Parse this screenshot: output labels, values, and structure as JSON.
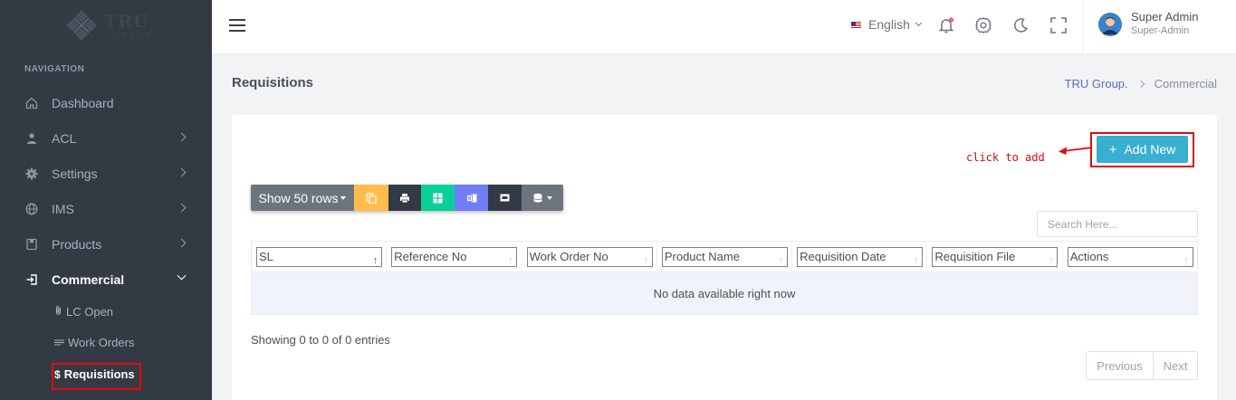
{
  "brand": {
    "name": "TRU",
    "sub": "GROUP"
  },
  "sidebar": {
    "nav_title": "NAVIGATION",
    "items": [
      {
        "label": "Dashboard",
        "icon": "home-icon"
      },
      {
        "label": "ACL",
        "icon": "user-icon"
      },
      {
        "label": "Settings",
        "icon": "gear-icon"
      },
      {
        "label": "IMS",
        "icon": "globe-icon"
      },
      {
        "label": "Products",
        "icon": "bookmark-icon"
      },
      {
        "label": "Commercial",
        "icon": "login-icon"
      }
    ],
    "sub_items": [
      {
        "label": "LC Open",
        "icon": "paperclip-icon"
      },
      {
        "label": "Work Orders",
        "icon": "lines-icon"
      },
      {
        "label": "Requisitions",
        "icon": "dollar-icon"
      }
    ]
  },
  "header": {
    "language": "English",
    "user_name": "Super Admin",
    "user_role": "Super-Admin"
  },
  "page": {
    "title": "Requisitions",
    "breadcrumb": [
      "TRU Group.",
      "Commercial"
    ]
  },
  "actions": {
    "add_new": "Add New",
    "hint": "click to add",
    "show_rows": "Show 50 rows"
  },
  "search": {
    "placeholder": "Search Here..."
  },
  "table": {
    "columns": [
      "SL",
      "Reference No",
      "Work Order No",
      "Product Name",
      "Requisition Date",
      "Requisition File",
      "Actions"
    ],
    "empty": "No data available right now"
  },
  "footer": {
    "info": "Showing 0 to 0 of 0 entries",
    "previous": "Previous",
    "next": "Next"
  },
  "colors": {
    "sidebar_bg": "#333a44",
    "accent": "#39afd1",
    "annotation": "#e3090d"
  }
}
